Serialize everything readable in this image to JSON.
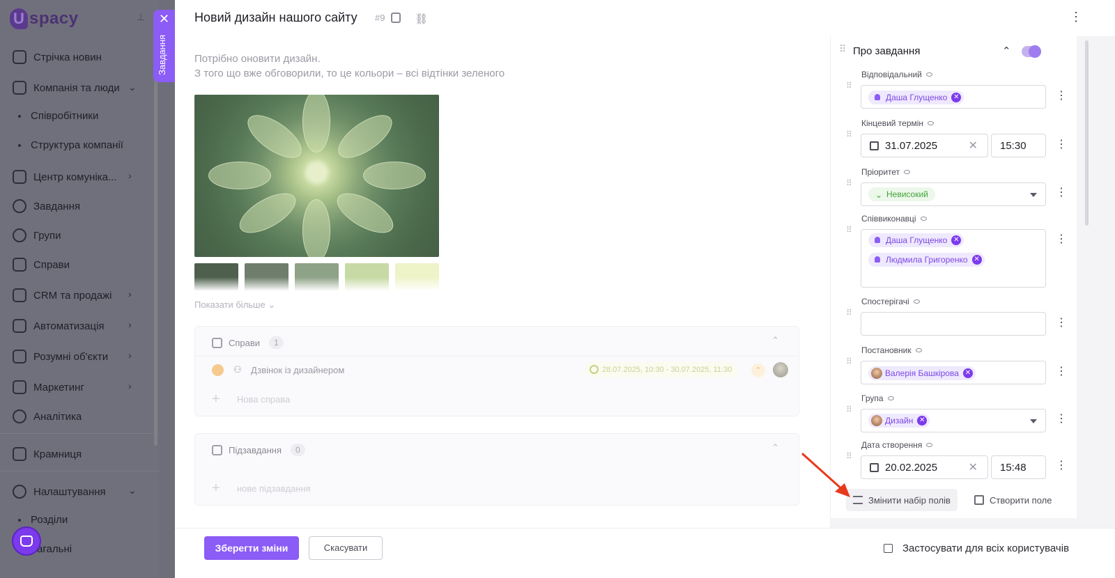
{
  "sidebar": {
    "logo_letter": "U",
    "logo_text": "spacy",
    "items": [
      {
        "label": "Стрічка новин",
        "icon": "home-icon"
      },
      {
        "label": "Компанія та люди",
        "icon": "building-icon"
      },
      {
        "label": "Співробітники",
        "icon": "dot-icon"
      },
      {
        "label": "Структура компанії",
        "icon": "dot-icon"
      },
      {
        "label": "Центр комуніка...",
        "icon": "chat-icon"
      },
      {
        "label": "Завдання",
        "icon": "check-circle-icon"
      },
      {
        "label": "Групи",
        "icon": "users-icon"
      },
      {
        "label": "Справи",
        "icon": "calendar-icon"
      },
      {
        "label": "CRM та продажі",
        "icon": "database-icon"
      },
      {
        "label": "Автоматизація",
        "icon": "bolt-icon"
      },
      {
        "label": "Розумні об'єкти",
        "icon": "smart-object-icon"
      },
      {
        "label": "Маркетинг",
        "icon": "megaphone-icon"
      },
      {
        "label": "Аналітика",
        "icon": "chart-icon"
      },
      {
        "label": "Крамниця",
        "icon": "store-icon"
      },
      {
        "label": "Налаштування",
        "icon": "gear-icon"
      },
      {
        "label": "Розділи",
        "icon": "dot-icon"
      },
      {
        "label": "Загальні",
        "icon": "dot-icon"
      }
    ]
  },
  "side_tab": {
    "label": "Завдання",
    "close": "✕"
  },
  "task": {
    "title": "Новий дизайн нашого сайту",
    "number": "#9",
    "description_line1": "Потрібно оновити дизайн.",
    "description_line2": "З того що вже обговорили, то це кольори – всі відтінки зеленого",
    "show_more": "Показати більше ⌄",
    "swatch_colors": [
      "#4e5f4d",
      "#6f7e6c",
      "#8ea287",
      "#c7d9a4",
      "#eef3c8"
    ]
  },
  "activities": {
    "title": "Справи",
    "count": "1",
    "item_text": "Дзвінок із дизайнером",
    "item_time": "28.07.2025, 10:30 - 30.07.2025, 11:30",
    "new_placeholder": "Нова справа"
  },
  "subtasks": {
    "title": "Підзавдання",
    "count": "0",
    "new_placeholder": "нове підзавдання"
  },
  "fields_panel": {
    "title": "Про завдання",
    "responsible": {
      "label": "Відповідальний",
      "value": "Даша Глущенко"
    },
    "deadline": {
      "label": "Кінцевий термін",
      "date": "31.07.2025",
      "time": "15:30"
    },
    "priority": {
      "label": "Пріоритет",
      "value": "Невисокий"
    },
    "coexecutors": {
      "label": "Співвиконавці",
      "values": [
        "Даша Глущенко",
        "Людмила Григоренко"
      ]
    },
    "observers": {
      "label": "Спостерігачі"
    },
    "creator": {
      "label": "Постановник",
      "value": "Валерія Башкірова"
    },
    "group": {
      "label": "Група",
      "value": "Дизайн"
    },
    "created": {
      "label": "Дата створення",
      "date": "20.02.2025",
      "time": "15:48"
    },
    "change_fields": "Змінити набір полів",
    "create_field": "Створити поле"
  },
  "footer": {
    "save": "Зберегти зміни",
    "cancel": "Скасувати",
    "apply_all": "Застосувати для всіх користувачів"
  },
  "colors": {
    "accent": "#8b5cf6",
    "overlay": "#6e6e7a",
    "annotation_arrow": "#e8391b"
  }
}
